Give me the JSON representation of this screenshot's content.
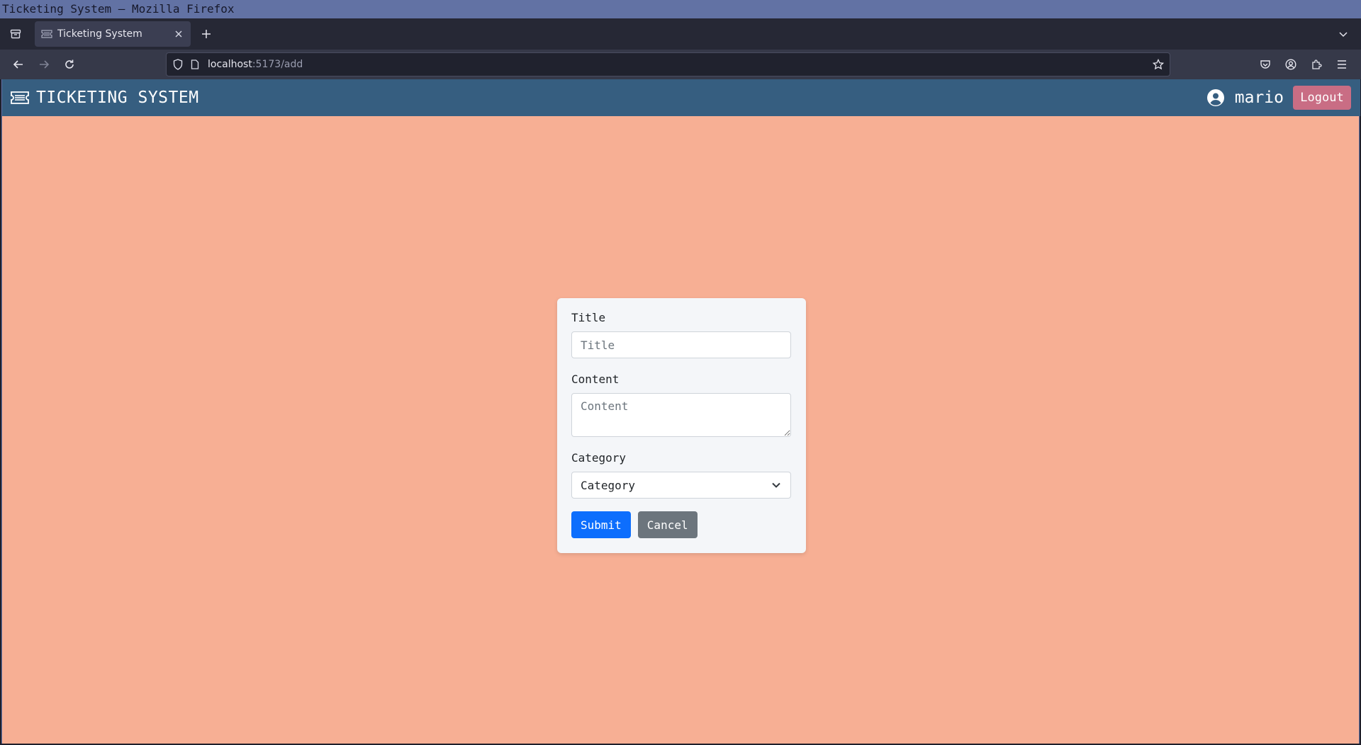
{
  "window": {
    "title": "Ticketing System — Mozilla Firefox"
  },
  "browser": {
    "tabs": [
      {
        "title": "Ticketing System",
        "icon": "ticket-icon",
        "active": true
      }
    ],
    "url_host": "localhost",
    "url_path": ":5173/add",
    "icons": {
      "overview": "tab-overview-icon",
      "new_tab": "plus-icon",
      "tab_list": "chevron-down-icon",
      "back": "back-arrow-icon",
      "forward": "forward-arrow-icon",
      "reload": "reload-icon",
      "shield": "shield-icon",
      "page": "page-icon",
      "bookmark": "star-icon",
      "pocket": "pocket-icon",
      "account": "account-icon",
      "extensions": "extensions-icon",
      "menu": "hamburger-menu-icon"
    }
  },
  "app": {
    "brand": "TICKETING SYSTEM",
    "brand_icon": "ticket-icon",
    "username": "mario",
    "user_icon": "user-circle-icon",
    "logout_label": "Logout",
    "colors": {
      "header": "#365e80",
      "background": "#f7af94",
      "logout": "#c96d84",
      "submit": "#0d6efd",
      "cancel": "#6c757d"
    }
  },
  "form": {
    "title_label": "Title",
    "title_placeholder": "Title",
    "title_value": "",
    "content_label": "Content",
    "content_placeholder": "Content",
    "content_value": "",
    "category_label": "Category",
    "category_selected": "Category",
    "submit_label": "Submit",
    "cancel_label": "Cancel"
  }
}
